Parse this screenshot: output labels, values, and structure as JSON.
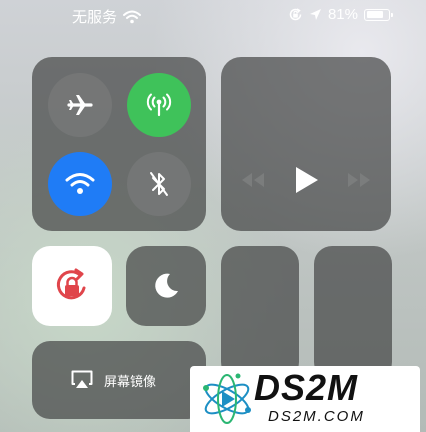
{
  "status_bar": {
    "carrier": "无服务",
    "battery_percent": "81%",
    "battery_level": 0.81,
    "icons": [
      "wifi-icon",
      "orientation-lock-icon",
      "location-arrow-icon",
      "battery-icon"
    ]
  },
  "connectivity": {
    "airplane": {
      "icon": "airplane-icon",
      "active": false
    },
    "cellular": {
      "icon": "cellular-antenna-icon",
      "active": true,
      "color": "#3fc25a"
    },
    "wifi": {
      "icon": "wifi-icon",
      "active": true,
      "color": "#1f7cf6"
    },
    "bluetooth": {
      "icon": "bluetooth-icon",
      "active": false
    }
  },
  "media": {
    "icons": [
      "rewind-icon",
      "play-icon",
      "fast-forward-icon"
    ]
  },
  "rotation_lock": {
    "icon": "rotation-lock-icon",
    "active": true,
    "color": "#e0454b"
  },
  "do_not_disturb": {
    "icon": "moon-icon",
    "active": false
  },
  "screen_mirroring": {
    "label": "屏幕镜像",
    "icon": "airplay-icon"
  },
  "watermark": {
    "title": "DS2M",
    "url": "DS2M.COM"
  }
}
